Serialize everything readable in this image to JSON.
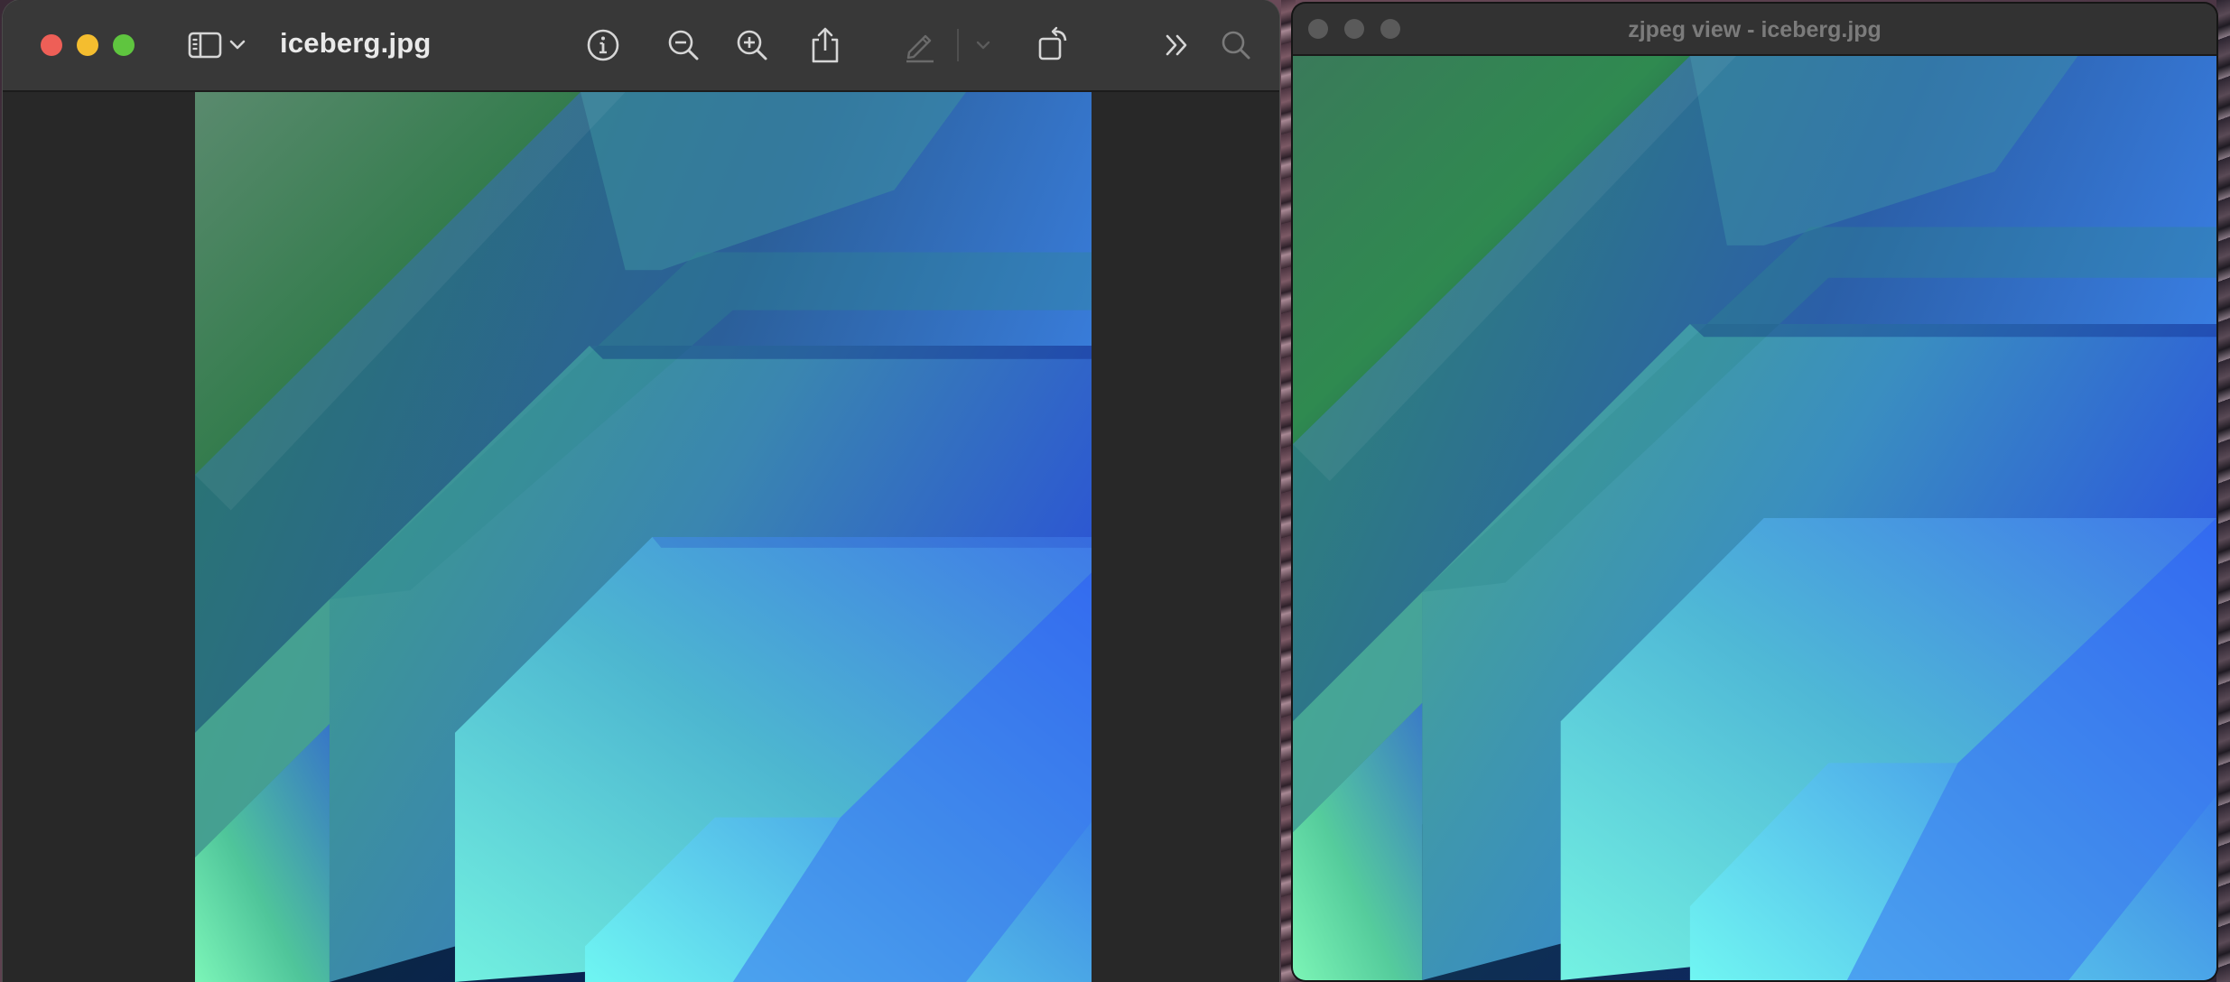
{
  "preview_window": {
    "title": "iceberg.jpg",
    "toolbar_icons": [
      "sidebar-icon",
      "chevron-down-icon",
      "info-icon",
      "zoom-out-icon",
      "zoom-in-icon",
      "share-icon",
      "markup-pen-icon",
      "chevron-down-icon",
      "rotate-icon",
      "overflow-chevrons-icon",
      "search-icon"
    ],
    "image_name": "iceberg.jpg"
  },
  "zjpeg_window": {
    "title": "zjpeg view - iceberg.jpg"
  },
  "colors": {
    "toolbar_bg": "#383838",
    "content_bg": "#282828",
    "close": "#ee5f57",
    "minimize": "#f4bd2f",
    "maximize": "#5fc53f",
    "inactive_traffic": "#5a5a5a",
    "image_green": "#4fc58a",
    "image_blue": "#2f63e6"
  }
}
